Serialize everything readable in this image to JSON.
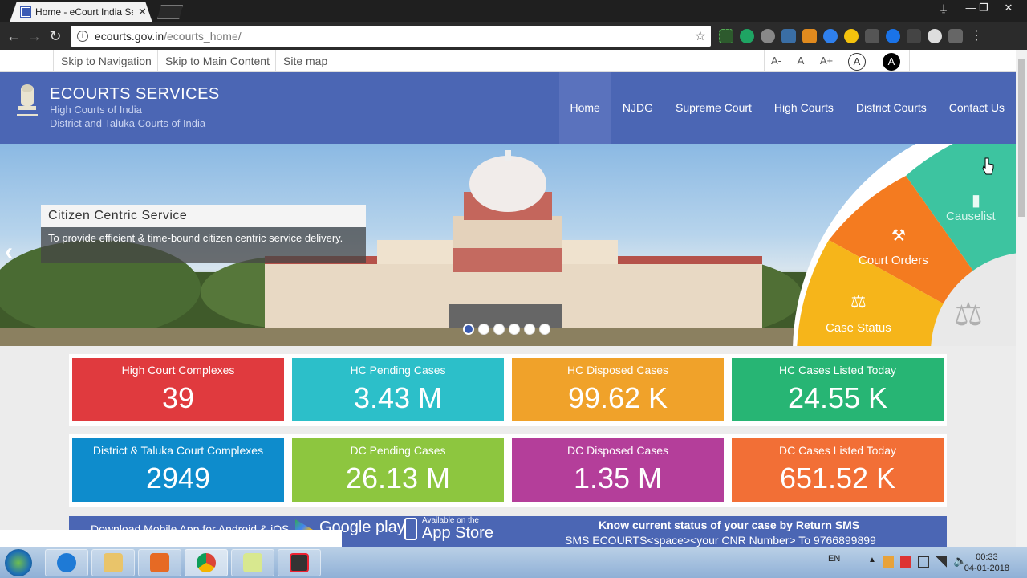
{
  "browser": {
    "tab_title": "Home - eCourt India Ser",
    "tab_close": "✕",
    "url_host": "ecourts.gov.in",
    "url_path": "/ecourts_home/",
    "back": "←",
    "forward": "→",
    "reload": "↻",
    "star": "☆",
    "minimize": "—",
    "maximize": "❐",
    "close": "✕",
    "user": "⍊"
  },
  "accessibility": {
    "skip_nav": "Skip to Navigation",
    "skip_main": "Skip to Main Content",
    "sitemap": "Site map",
    "font_smaller": "A-",
    "font_normal": "A",
    "font_larger": "A+",
    "contrast_light": "A",
    "contrast_dark": "A"
  },
  "header": {
    "title": "ECOURTS SERVICES",
    "subtitle1": "High Courts of India",
    "subtitle2": "District and Taluka Courts of India",
    "nav": [
      "Home",
      "NJDG",
      "Supreme Court",
      "High Courts",
      "District Courts",
      "Contact Us"
    ]
  },
  "hero": {
    "caption_title": "Citizen Centric Service",
    "caption_body": "To provide efficient & time-bound citizen centric service delivery.",
    "prev": "‹",
    "next": "›",
    "wheel": {
      "causelist": "Causelist",
      "court_orders": "Court Orders",
      "case_status": "Case Status"
    }
  },
  "stats": [
    {
      "label": "High Court Complexes",
      "value": "39",
      "color": "#e03a3e"
    },
    {
      "label": "HC Pending Cases",
      "value": "3.43 M",
      "color": "#2cbfc9"
    },
    {
      "label": "HC Disposed Cases",
      "value": "99.62 K",
      "color": "#f0a22a"
    },
    {
      "label": "HC Cases Listed Today",
      "value": "24.55 K",
      "color": "#27b574"
    },
    {
      "label": "District & Taluka Court Complexes",
      "value": "2949",
      "color": "#0e8ccc"
    },
    {
      "label": "DC Pending Cases",
      "value": "26.13 M",
      "color": "#8dc63f"
    },
    {
      "label": "DC Disposed Cases",
      "value": "1.35 M",
      "color": "#b43e9a"
    },
    {
      "label": "DC Cases Listed Today",
      "value": "651.52 K",
      "color": "#f26f36"
    }
  ],
  "bottom": {
    "download": "Download Mobile App for Android & iOS",
    "google_play": "Google play",
    "app_store_small": "Available on the",
    "app_store": "App Store",
    "sms_title": "Know current status of your case by Return SMS",
    "sms_body": "SMS ECOURTS<space><your CNR Number> To 9766899899"
  },
  "taskbar": {
    "lang": "EN",
    "time": "00:33",
    "date": "04-01-2018"
  }
}
